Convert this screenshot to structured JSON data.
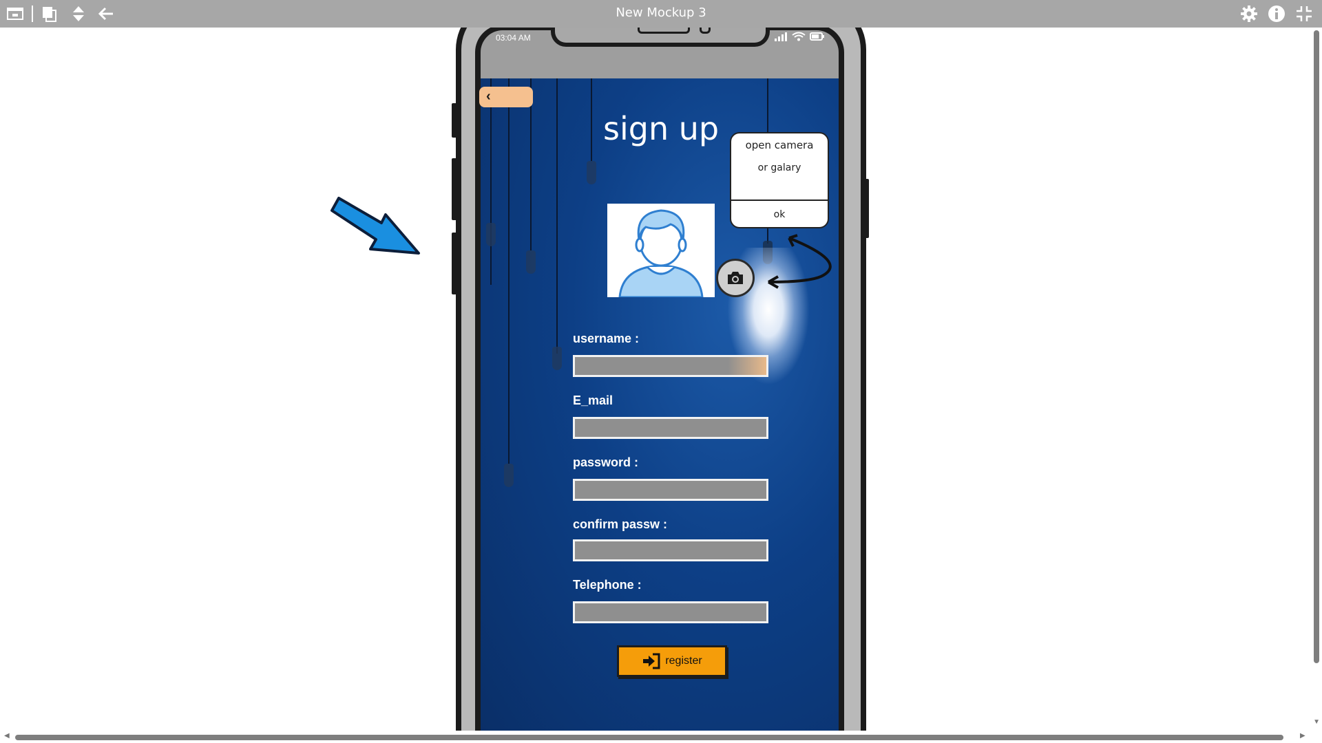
{
  "window": {
    "title": "New Mockup 3"
  },
  "toolbar": {
    "left_icons": [
      "window-icon",
      "copy-icon",
      "sort-icon",
      "back-arrow-icon"
    ],
    "right_icons": [
      "gear-icon",
      "info-icon",
      "exit-fullscreen-icon"
    ]
  },
  "phone": {
    "status_time": "03:04 AM",
    "status_icons": [
      "signal-icon",
      "wifi-icon",
      "battery-icon"
    ]
  },
  "screen": {
    "back_label": "‹",
    "title": "sign up",
    "popup": {
      "line1": "open camera",
      "line2": "or galary",
      "ok_label": "ok"
    },
    "fields": [
      {
        "label": "username :"
      },
      {
        "label": "E_mail"
      },
      {
        "label": "password :"
      },
      {
        "label": "confirm passw :"
      },
      {
        "label": "Telephone :"
      }
    ],
    "register_label": "register"
  },
  "colors": {
    "toolbar": "#a7a7a7",
    "screen_bg": "#0d3f86",
    "back_button": "#f5c08f",
    "register_button": "#f59d0a",
    "input_fill": "#8f8f8f",
    "annotation_arrow": "#1a8fe0"
  }
}
